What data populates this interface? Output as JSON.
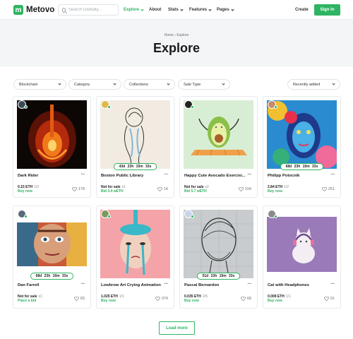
{
  "brand": {
    "logo_mark": "m",
    "name": "Metovo",
    "accent": "#2eb462"
  },
  "search": {
    "placeholder": "Search Globally..."
  },
  "nav": {
    "explore": "Explore",
    "about": "About",
    "stats": "Stats",
    "features": "Features",
    "pages": "Pages",
    "create": "Create",
    "signin": "Sign In"
  },
  "hero": {
    "breadcrumb_home": "Home",
    "breadcrumb_sep": "›",
    "breadcrumb_current": "Explore",
    "title": "Explore"
  },
  "filters": {
    "blockchain": "Blockchain",
    "category": "Category",
    "collections": "Collections",
    "sale_type": "Sale Type",
    "sort": "Recently added"
  },
  "cards": [
    {
      "title": "Dark Rider",
      "price": "0.15 ETH",
      "edition": "1/2",
      "action": "Buy now",
      "likes": "178",
      "timer": ""
    },
    {
      "title": "Boston Public Library",
      "price": "Not for sale",
      "edition": "x1",
      "action": "Bid 3.4 wETH",
      "likes": "14",
      "timer": "43d 23h 19m 33s"
    },
    {
      "title": "Happy Cute Avocado Exercisi...",
      "price": "Not for sale",
      "edition": "x2",
      "action": "Bid 5.7 wETH",
      "likes": "104",
      "timer": ""
    },
    {
      "title": "Philipp Potocnik",
      "price": "2.84 ETH",
      "edition": "1/2",
      "action": "Buy now",
      "likes": "251",
      "timer": "68d 23h 19m 33s"
    },
    {
      "title": "Dan Farrell",
      "price": "Not for sale",
      "edition": "x1",
      "action": "Place a bid",
      "likes": "83",
      "timer": "68d 23h 19m 33s"
    },
    {
      "title": "Lowbrow Art Crying Animation",
      "price": "1.025 ETH",
      "edition": "1/1",
      "action": "Buy now",
      "likes": "374",
      "timer": ""
    },
    {
      "title": "Pascal Bernardon",
      "price": "0.035 ETH",
      "edition": "1/5",
      "action": "Buy now",
      "likes": "68",
      "timer": "51d 23h 19m 33s"
    },
    {
      "title": "Cat with Headphones",
      "price": "0.009 ETH",
      "edition": "1/1",
      "action": "Buy now",
      "likes": "91",
      "timer": ""
    }
  ],
  "more_glyph": "···",
  "load_more": "Load more"
}
